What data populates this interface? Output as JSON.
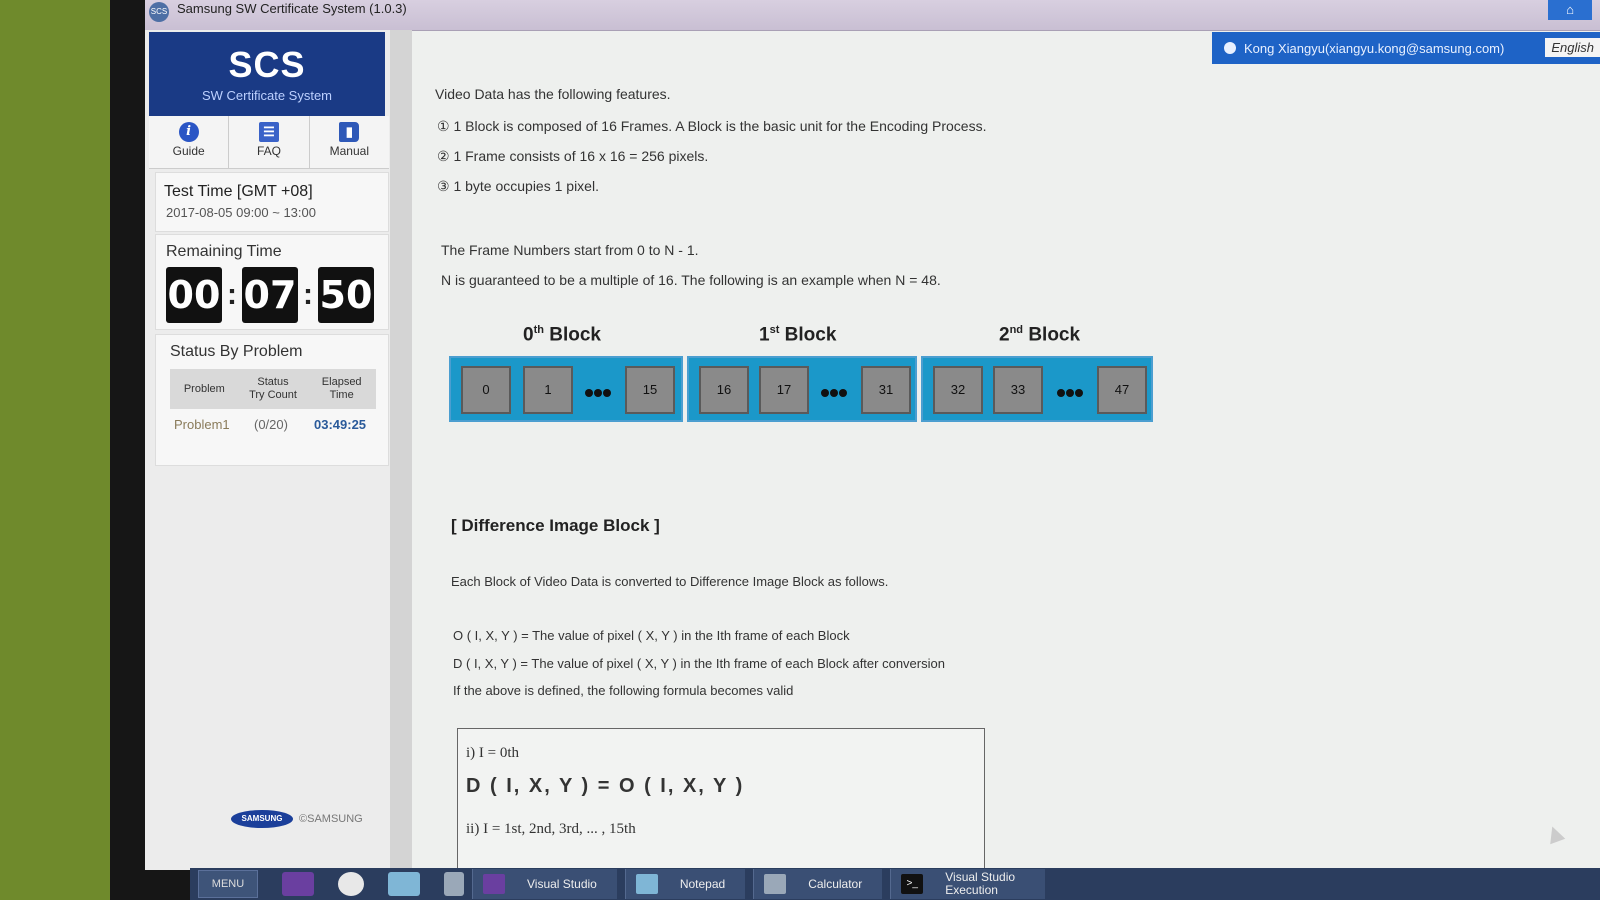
{
  "window": {
    "title": "Samsung SW Certificate System (1.0.3)",
    "home_label": "⌂",
    "icon_label": "SCS"
  },
  "sidebar": {
    "logo_big": "SCS",
    "logo_small": "SW Certificate System",
    "nav": [
      {
        "label": "Guide",
        "icon": "info-icon",
        "glyph": "i"
      },
      {
        "label": "FAQ",
        "icon": "faq-list-icon",
        "glyph": "☰"
      },
      {
        "label": "Manual",
        "icon": "manual-book-icon",
        "glyph": "▮"
      }
    ],
    "test_time_label": "Test Time [GMT +08]",
    "test_time_value": "2017-08-05 09:00 ~ 13:00",
    "remaining_label": "Remaining Time",
    "remaining": {
      "hh": "00",
      "mm": "07",
      "ss": "50"
    },
    "status_label": "Status By Problem",
    "status_headers": [
      "Problem",
      "Status\nTry Count",
      "Elapsed\nTime"
    ],
    "status_rows": [
      {
        "problem": "Problem1",
        "try_count": "(0/20)",
        "elapsed": "03:49:25"
      }
    ],
    "brand_logo": "SAMSUNG",
    "brand_copy": "©SAMSUNG"
  },
  "header": {
    "user": "Kong Xiangyu(xiangyu.kong@samsung.com)",
    "language": "English"
  },
  "content": {
    "intro": "Video Data has the following features.",
    "features": [
      "① 1 Block is composed of 16 Frames. A Block is the basic unit for the Encoding Process.",
      "② 1 Frame consists of 16 x 16 = 256 pixels.",
      "③ 1 byte occupies 1 pixel."
    ],
    "note1": "The Frame Numbers start from 0 to N - 1.",
    "note2": "N is guaranteed to be a multiple of 16. The following is an example when N = 48.",
    "blocks": [
      {
        "ordinal": "0",
        "sup": "th",
        "word": "Block",
        "frames": [
          "0",
          "1",
          "15"
        ]
      },
      {
        "ordinal": "1",
        "sup": "st",
        "word": "Block",
        "frames": [
          "16",
          "17",
          "31"
        ]
      },
      {
        "ordinal": "2",
        "sup": "nd",
        "word": "Block",
        "frames": [
          "32",
          "33",
          "47"
        ]
      }
    ],
    "diff_title": "[ Difference Image Block ]",
    "diff_desc": "Each Block of Video Data is converted to Difference Image Block as follows.",
    "def_o": "O ( I, X, Y ) = The value of pixel ( X, Y ) in the Ith frame of each Block",
    "def_d": "D ( I, X, Y ) = The value of pixel ( X, Y ) in the Ith frame of each Block after conversion",
    "def_valid": "If the above is defined, the following formula becomes valid",
    "formula": {
      "case1": "i) I = 0th",
      "eq1": "D ( I, X, Y ) = O ( I, X, Y )",
      "case2": "ii) I = 1st, 2nd, 3rd, ... , 15th"
    }
  },
  "taskbar": {
    "menu": "MENU",
    "items": [
      "Visual Studio",
      "Notepad",
      "Calculator",
      "Visual Studio Execution"
    ]
  },
  "colors": {
    "accent": "#1e63c6",
    "logo_bg": "#1a3a85",
    "block_bg": "#1b98c9",
    "frame_bg": "#8a8a8a"
  }
}
